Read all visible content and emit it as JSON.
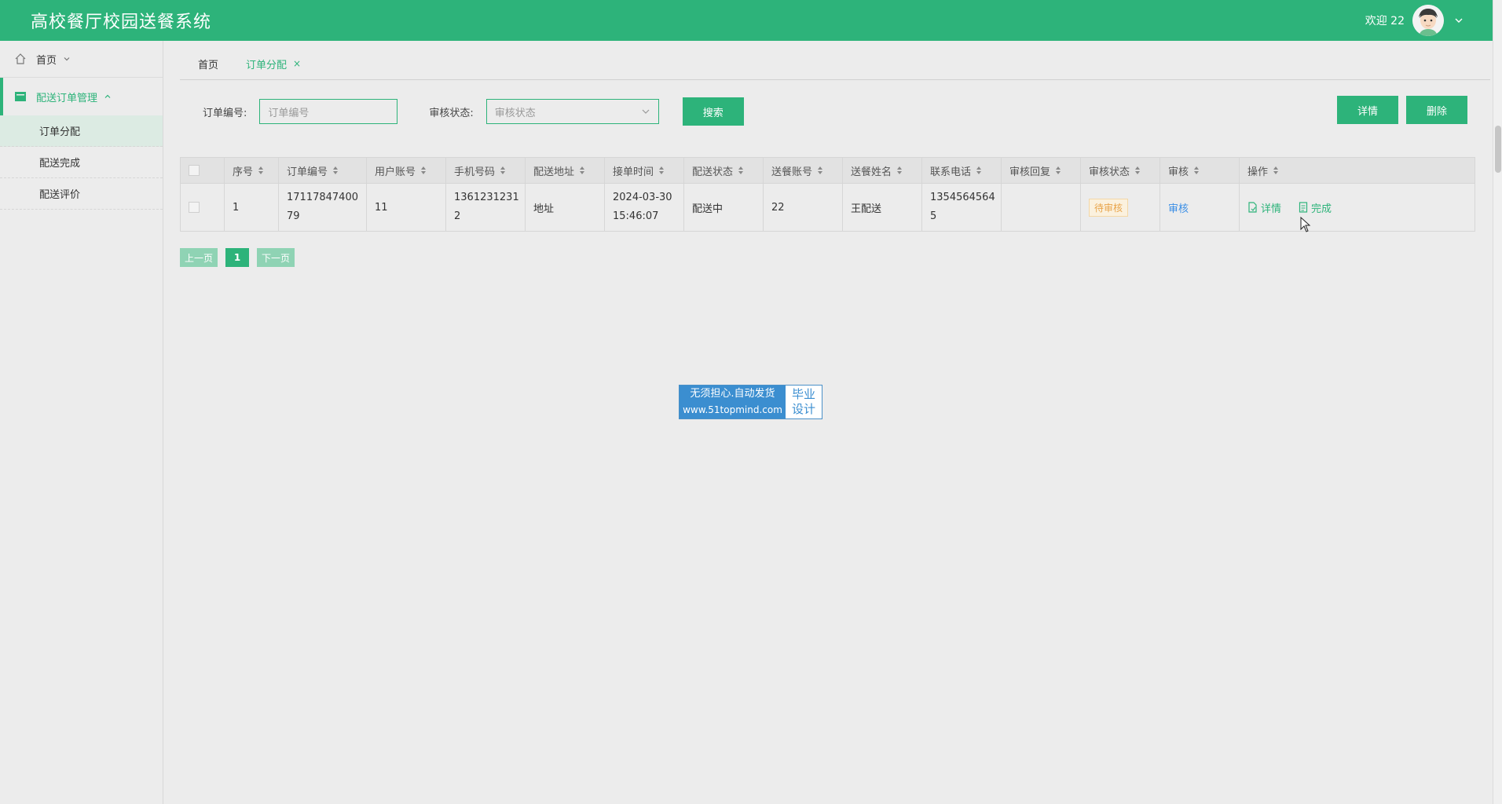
{
  "header": {
    "title": "高校餐厅校园送餐系统",
    "welcome": "欢迎 22"
  },
  "sidebar": {
    "home": "首页",
    "group": "配送订单管理",
    "items": [
      {
        "label": "订单分配",
        "active": true
      },
      {
        "label": "配送完成",
        "active": false
      },
      {
        "label": "配送评价",
        "active": false
      }
    ]
  },
  "tabs": [
    {
      "label": "首页"
    },
    {
      "label": "订单分配",
      "close": "×"
    }
  ],
  "filters": {
    "order_no_label": "订单编号:",
    "order_no_placeholder": "订单编号",
    "status_label": "审核状态:",
    "status_placeholder": "审核状态",
    "search_label": "搜索"
  },
  "actions": {
    "detail_label": "详情",
    "delete_label": "删除"
  },
  "table": {
    "headers": [
      "序号",
      "订单编号",
      "用户账号",
      "手机号码",
      "配送地址",
      "接单时间",
      "配送状态",
      "送餐账号",
      "送餐姓名",
      "联系电话",
      "审核回复",
      "审核状态",
      "审核",
      "操作"
    ],
    "rows": [
      {
        "index": "1",
        "order_no": [
          "17117847400",
          "79"
        ],
        "user": "11",
        "phone": [
          "1361231231",
          "2"
        ],
        "address": "地址",
        "time": [
          "2024-03-30",
          "15:46:07"
        ],
        "delivery_status": "配送中",
        "courier_account": "22",
        "courier_name": "王配送",
        "contact": [
          "1354564564",
          "5"
        ],
        "review_reply": "",
        "review_status": "待审核",
        "review_action": "审核",
        "op_detail": "详情",
        "op_complete": "完成"
      }
    ]
  },
  "pager": {
    "prev": "上一页",
    "current": "1",
    "next": "下一页"
  },
  "watermark": {
    "line1": "无须担心.自动发货",
    "line2": "www.51topmind.com",
    "right1": "毕业",
    "right2": "设计"
  },
  "colors": {
    "accent": "#2db37a",
    "link": "#3a8ee6",
    "pending": "#e8a44a"
  }
}
